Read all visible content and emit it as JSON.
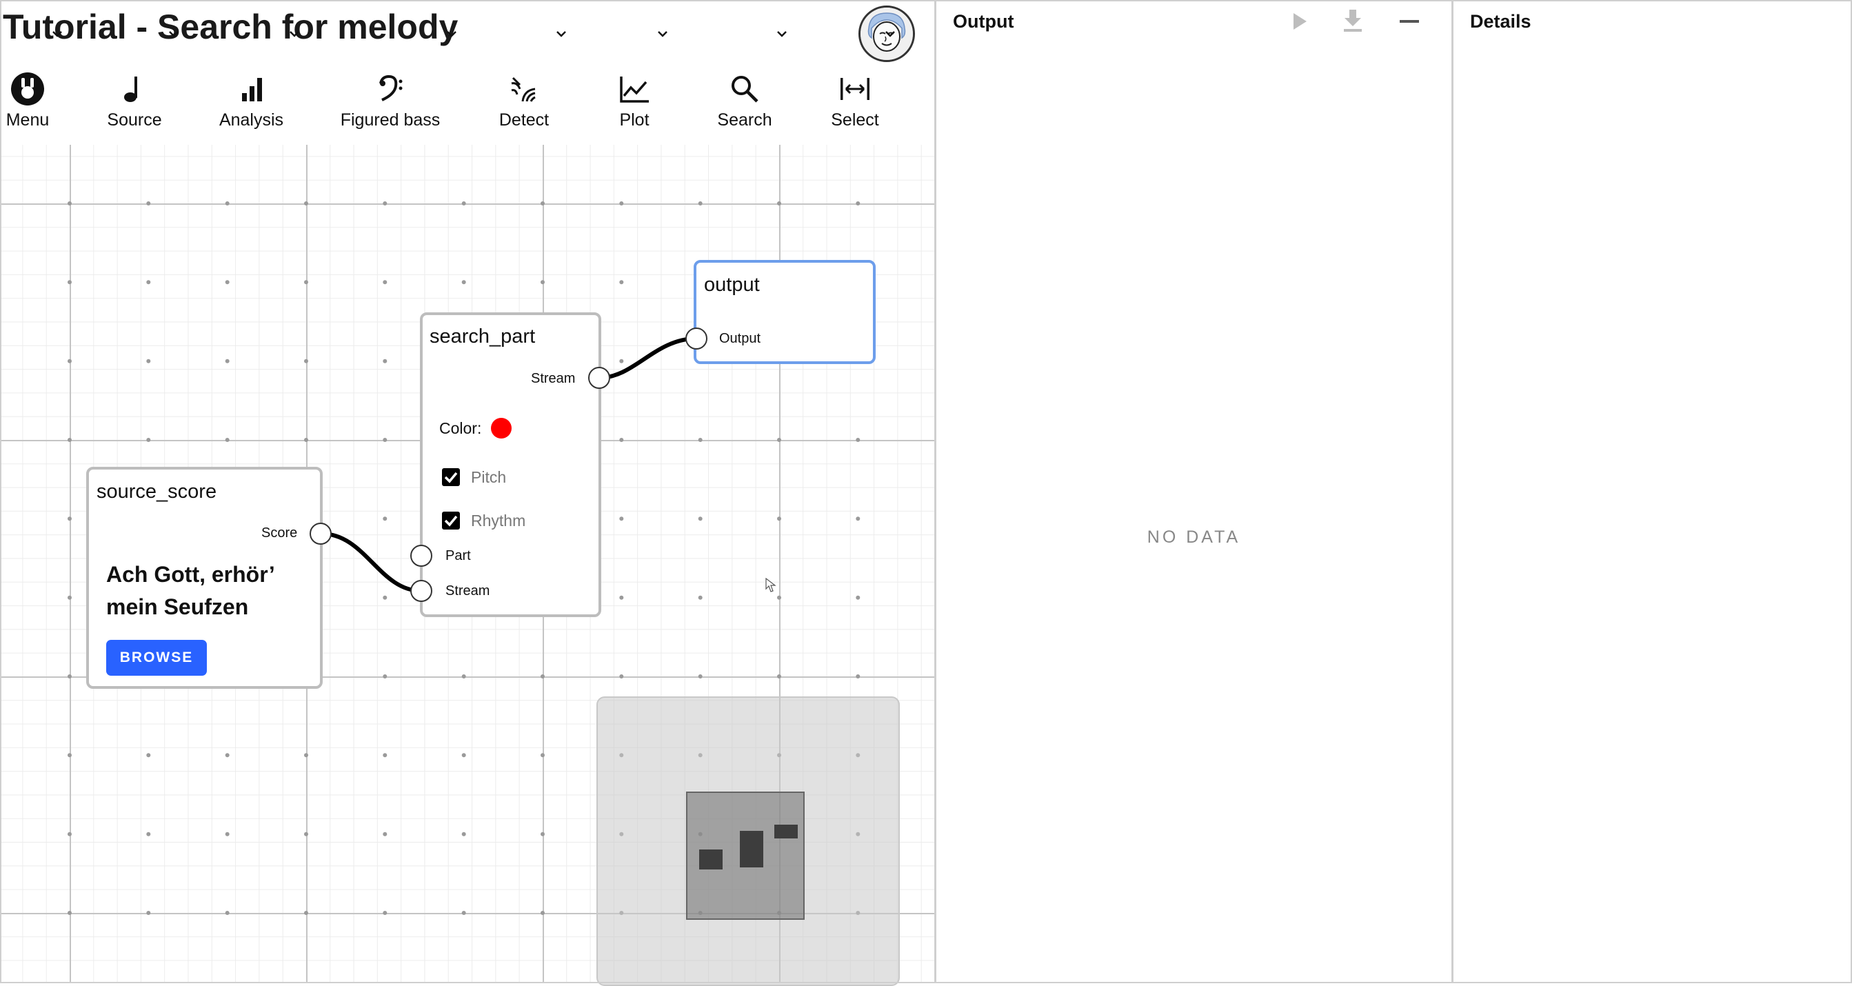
{
  "app": {
    "title": "Tutorial - Search for melody"
  },
  "toolbar": {
    "items": [
      {
        "label": "Menu",
        "icon": "menu-logo-icon"
      },
      {
        "label": "Source",
        "icon": "music-note-icon"
      },
      {
        "label": "Analysis",
        "icon": "bar-chart-icon"
      },
      {
        "label": "Figured bass",
        "icon": "bass-clef-icon"
      },
      {
        "label": "Detect",
        "icon": "detect-signal-icon"
      },
      {
        "label": "Plot",
        "icon": "line-chart-icon"
      },
      {
        "label": "Search",
        "icon": "search-icon"
      },
      {
        "label": "Select",
        "icon": "select-range-icon"
      }
    ]
  },
  "nodes": {
    "source_score": {
      "title": "source_score",
      "output_port": "Score",
      "score_title": "Ach Gott, erhör’ mein Seufzen",
      "browse_label": "BROWSE"
    },
    "search_part": {
      "title": "search_part",
      "output_port": "Stream",
      "color_label": "Color:",
      "color_value": "#ff0000",
      "pitch_label": "Pitch",
      "pitch_checked": true,
      "rhythm_label": "Rhythm",
      "rhythm_checked": true,
      "input_part": "Part",
      "input_stream": "Stream"
    },
    "output": {
      "title": "output",
      "input_port": "Output"
    }
  },
  "output_panel": {
    "title": "Output",
    "empty_text": "NO DATA"
  },
  "details_panel": {
    "title": "Details"
  },
  "colors": {
    "accent": "#2962ff",
    "selected_node_border": "#6d9eeb",
    "node_border": "#bdbdbd"
  }
}
